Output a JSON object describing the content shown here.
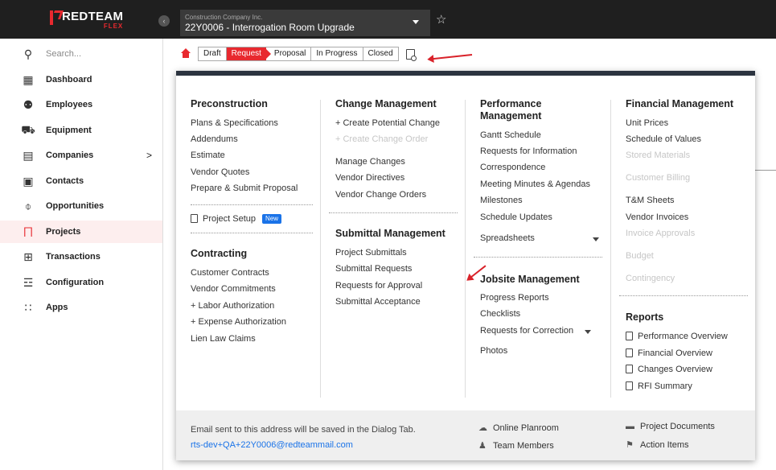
{
  "brand": {
    "name": "REDTEAM",
    "sub": "FLEX"
  },
  "header": {
    "company": "Construction Company Inc.",
    "project": "22Y0006 - Interrogation Room Upgrade"
  },
  "sidebar": {
    "search": "Search...",
    "items": [
      {
        "label": "Dashboard",
        "icon": "dashboard-icon"
      },
      {
        "label": "Employees",
        "icon": "employees-icon"
      },
      {
        "label": "Equipment",
        "icon": "equipment-icon"
      },
      {
        "label": "Companies",
        "icon": "companies-icon",
        "chevron": ">"
      },
      {
        "label": "Contacts",
        "icon": "contacts-icon"
      },
      {
        "label": "Opportunities",
        "icon": "opportunities-icon"
      },
      {
        "label": "Projects",
        "icon": "projects-icon"
      },
      {
        "label": "Transactions",
        "icon": "transactions-icon"
      },
      {
        "label": "Configuration",
        "icon": "configuration-icon"
      },
      {
        "label": "Apps",
        "icon": "apps-icon"
      }
    ]
  },
  "status": {
    "stages": [
      "Draft",
      "Request",
      "Proposal",
      "In Progress",
      "Closed"
    ],
    "active": "Request"
  },
  "menu": {
    "preconstruction": {
      "title": "Preconstruction",
      "items": [
        "Plans & Specifications",
        "Addendums",
        "Estimate",
        "Vendor Quotes",
        "Prepare & Submit Proposal"
      ],
      "setup": "Project Setup",
      "badge": "New"
    },
    "contracting": {
      "title": "Contracting",
      "items": [
        "Customer Contracts",
        "Vendor Commitments",
        "+ Labor Authorization",
        "+ Expense Authorization",
        "Lien Law Claims"
      ]
    },
    "change": {
      "title": "Change Management",
      "create1": "+ Create Potential Change",
      "create2": "+ Create Change Order",
      "items": [
        "Manage Changes",
        "Vendor Directives",
        "Vendor Change Orders"
      ]
    },
    "submittal": {
      "title": "Submittal Management",
      "items": [
        "Project Submittals",
        "Submittal Requests",
        "Requests for Approval",
        "Submittal Acceptance"
      ]
    },
    "performance": {
      "title1": "Performance",
      "title2": "Management",
      "items": [
        "Gantt Schedule",
        "Requests for Information",
        "Correspondence",
        "Meeting Minutes & Agendas",
        "Milestones",
        "Schedule Updates"
      ],
      "spreadsheets": "Spreadsheets"
    },
    "jobsite": {
      "title": "Jobsite Management",
      "items": [
        "Progress Reports",
        "Checklists"
      ],
      "rfc": "Requests for Correction",
      "photos": "Photos"
    },
    "financial": {
      "title": "Financial Management",
      "unit_prices": "Unit Prices",
      "sov": "Schedule of Values",
      "stored": "Stored Materials",
      "billing": "Customer Billing",
      "tm": "T&M Sheets",
      "vinv": "Vendor Invoices",
      "invappr": "Invoice Approvals",
      "budget": "Budget",
      "contingency": "Contingency"
    },
    "reports": {
      "title": "Reports",
      "items": [
        "Performance Overview",
        "Financial Overview",
        "Changes Overview",
        "RFI Summary"
      ]
    }
  },
  "footer": {
    "note": "Email sent to this address will be saved in the Dialog Tab.",
    "email": "rts-dev+QA+22Y0006@redteammail.com",
    "planroom": "Online Planroom",
    "team": "Team Members",
    "docs": "Project Documents",
    "actions": "Action Items"
  },
  "colors": {
    "accent": "#e8292f",
    "link": "#1a73e8",
    "topbar": "#1f1f1f",
    "panel_header": "#2c3440"
  }
}
